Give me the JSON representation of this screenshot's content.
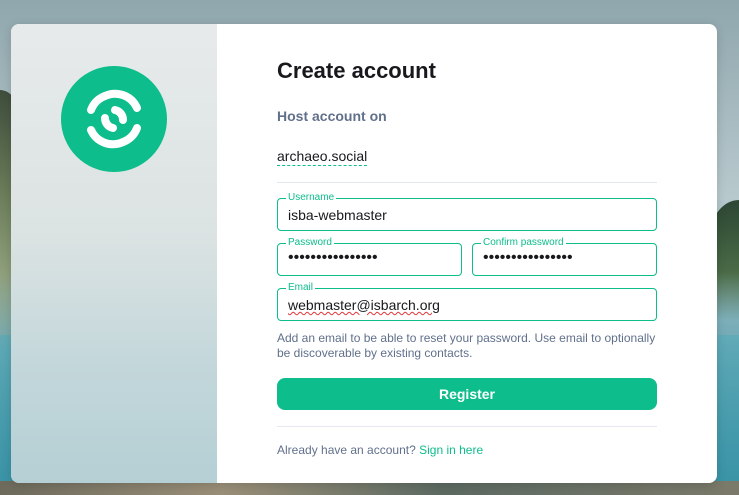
{
  "form": {
    "title": "Create account",
    "host_label": "Host account on",
    "host_value": "archaeo.social",
    "username": {
      "label": "Username",
      "value": "isba-webmaster"
    },
    "password": {
      "label": "Password",
      "masked": "••••••••••••••••"
    },
    "confirm_password": {
      "label": "Confirm password",
      "masked": "••••••••••••••••"
    },
    "email": {
      "label": "Email",
      "value": "webmaster@isbarch.org"
    },
    "email_hint": "Add an email to be able to reset your password. Use email to optionally be discoverable by existing contacts.",
    "register_label": "Register",
    "footer_prompt": "Already have an account?",
    "signin_label": "Sign in here"
  },
  "branding": {
    "logo_icon": "element-logo-icon",
    "accent_color": "#0dbd8b"
  }
}
